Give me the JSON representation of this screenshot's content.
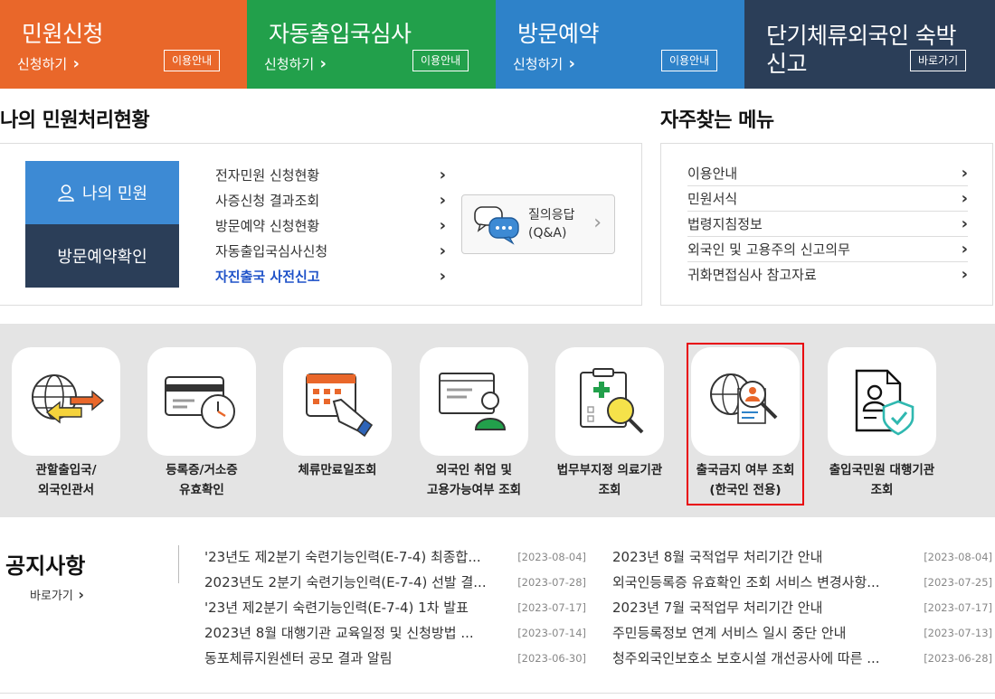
{
  "tiles": [
    {
      "title": "민원신청",
      "sub": "신청하기",
      "btn": "이용안내",
      "color": "#e9672a"
    },
    {
      "title": "자동출입국심사",
      "sub": "신청하기",
      "btn": "이용안내",
      "color": "#22a04b"
    },
    {
      "title": "방문예약",
      "sub": "신청하기",
      "btn": "이용안내",
      "color": "#2e82c9"
    },
    {
      "title": "단기체류외국인 숙박\n신고",
      "btn": "바로가기",
      "color": "#2b3e58"
    }
  ],
  "status": {
    "title": "나의 민원처리현황",
    "my_label": "나의 민원",
    "visit_label": "방문예약확인",
    "items": [
      "전자민원 신청현황",
      "사증신청 결과조회",
      "방문예약 신청현황",
      "자동출입국심사신청",
      "자진출국 사전신고"
    ],
    "qa_label": "질의응답\n(Q&A)"
  },
  "freq": {
    "title": "자주찾는 메뉴",
    "items": [
      "이용안내",
      "민원서식",
      "법령지침정보",
      "외국인 및 고용주의 신고의무",
      "귀화면접심사 참고자료"
    ]
  },
  "services": [
    {
      "label": "관할출입국/\n외국인관서",
      "icon": "globe-arrows-icon"
    },
    {
      "label": "등록증/거소증\n유효확인",
      "icon": "card-clock-icon"
    },
    {
      "label": "체류만료일조회",
      "icon": "calendar-hand-icon"
    },
    {
      "label": "외국인 취업 및\n고용가능여부 조회",
      "icon": "worker-screen-icon"
    },
    {
      "label": "법무부지정 의료기관\n조회",
      "icon": "clipboard-search-icon"
    },
    {
      "label": "출국금지 여부 조회\n(한국인 전용)",
      "icon": "globe-person-search-icon"
    },
    {
      "label": "출입국민원 대행기관\n조회",
      "icon": "document-shield-icon"
    }
  ],
  "notice": {
    "title": "공지사항",
    "more": "바로가기",
    "left": [
      {
        "t": "'23년도 제2분기 숙련기능인력(E-7-4) 최종합...",
        "d": "[2023-08-04]"
      },
      {
        "t": "2023년도 2분기 숙련기능인력(E-7-4) 선발 결...",
        "d": "[2023-07-28]"
      },
      {
        "t": "'23년 제2분기 숙련기능인력(E-7-4) 1차 발표",
        "d": "[2023-07-17]"
      },
      {
        "t": "2023년 8월 대행기관 교육일정 및 신청방법 ...",
        "d": "[2023-07-14]"
      },
      {
        "t": "동포체류지원센터 공모 결과 알림",
        "d": "[2023-06-30]"
      }
    ],
    "right": [
      {
        "t": "2023년 8월 국적업무 처리기간 안내",
        "d": "[2023-08-04]"
      },
      {
        "t": "외국인등록증 유효확인 조회 서비스 변경사항...",
        "d": "[2023-07-25]"
      },
      {
        "t": "2023년 7월 국적업무 처리기간 안내",
        "d": "[2023-07-17]"
      },
      {
        "t": "주민등록정보 연계 서비스 일시 중단 안내",
        "d": "[2023-07-13]"
      },
      {
        "t": "청주외국인보호소 보호시설 개선공사에 따른 ...",
        "d": "[2023-06-28]"
      }
    ]
  }
}
